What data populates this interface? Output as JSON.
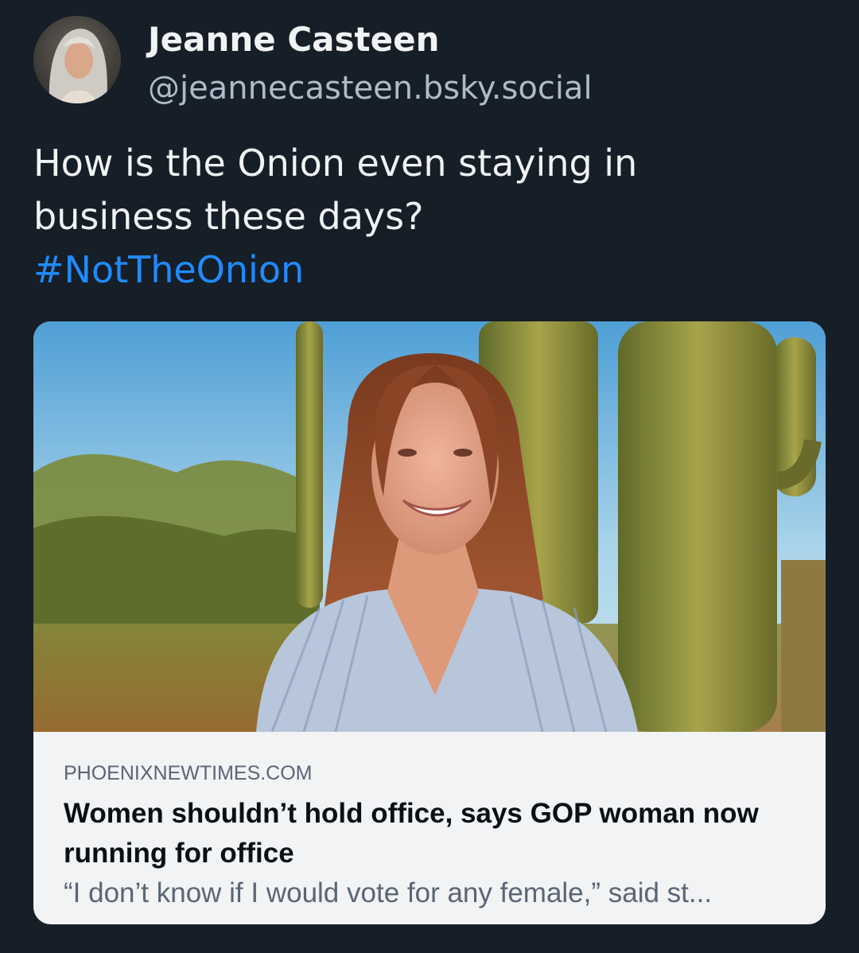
{
  "author": {
    "name": "Jeanne Casteen",
    "handle": "@jeannecasteen.bsky.social",
    "avatar_icon": "profile-photo"
  },
  "post": {
    "text_line1": "How is the Onion even staying in",
    "text_line2": "business these days?",
    "hashtag": "#NotTheOnion"
  },
  "link_card": {
    "image_icon": "article-photo-woman-cactus",
    "domain": "PHOENIXNEWTIMES.COM",
    "title": "Women shouldn’t hold office, says GOP woman now running for office",
    "description": "“I don’t know if I would vote for any female,” said st..."
  },
  "colors": {
    "background": "#161e27",
    "text_primary": "#f1f3f5",
    "text_secondary": "#aebbc9",
    "link": "#208bfe",
    "card_background": "#f1f3f5"
  }
}
